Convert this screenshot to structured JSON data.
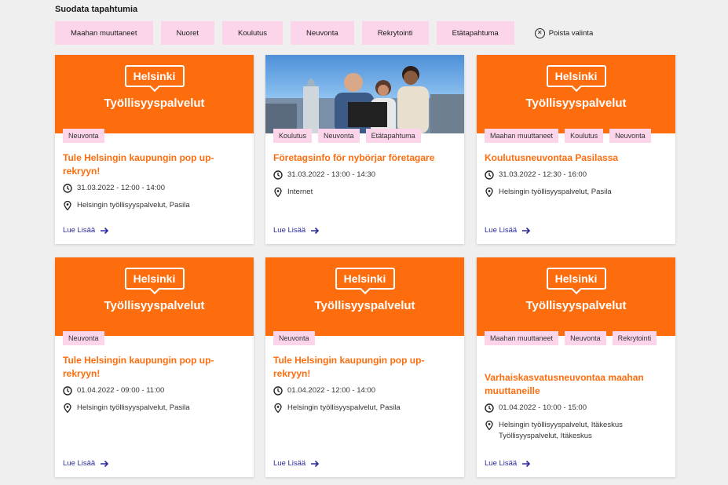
{
  "filter": {
    "title": "Suodata tapahtumia",
    "chips": [
      "Maahan muuttaneet",
      "Nuoret",
      "Koulutus",
      "Neuvonta",
      "Rekrytointi",
      "Etätapahtuma"
    ],
    "clear_label": "Poista valinta"
  },
  "brand": {
    "logo": "Helsinki",
    "subtitle": "Työllisyyspalvelut"
  },
  "read_more": "Lue Lisää",
  "cards": [
    {
      "tags": [
        "Neuvonta"
      ],
      "title": "Tule Helsingin kaupungin pop up-rekryyn!",
      "time": "31.03.2022 - 12:00 - 14:00",
      "location": "Helsingin työllisyyspalvelut, Pasila"
    },
    {
      "tags": [
        "Koulutus",
        "Neuvonta",
        "Etätapahtuma"
      ],
      "title": "Företagsinfo för nybörjar företagare",
      "time": "31.03.2022 - 13:00 - 14:30",
      "location": "Internet"
    },
    {
      "tags": [
        "Maahan muuttaneet",
        "Koulutus",
        "Neuvonta"
      ],
      "title": "Koulutusneuvontaa Pasilassa",
      "time": "31.03.2022 - 12:30 - 16:00",
      "location": "Helsingin työllisyyspalvelut, Pasila"
    },
    {
      "tags": [
        "Neuvonta"
      ],
      "title": "Tule Helsingin kaupungin pop up-rekryyn!",
      "time": "01.04.2022 - 09:00 - 11:00",
      "location": "Helsingin työllisyyspalvelut, Pasila"
    },
    {
      "tags": [
        "Neuvonta"
      ],
      "title": "Tule Helsingin kaupungin pop up-rekryyn!",
      "time": "01.04.2022 - 12:00 - 14:00",
      "location": "Helsingin työllisyyspalvelut, Pasila"
    },
    {
      "tags": [
        "Maahan muuttaneet",
        "Neuvonta",
        "Rekrytointi"
      ],
      "title": "Varhaiskasvatusneuvontaa maahan muuttaneille",
      "time": "01.04.2022 - 10:00 - 15:00",
      "location": "Helsingin työllisyyspalvelut, Itäkeskus Työllisyyspalvelut, Itäkeskus"
    }
  ]
}
